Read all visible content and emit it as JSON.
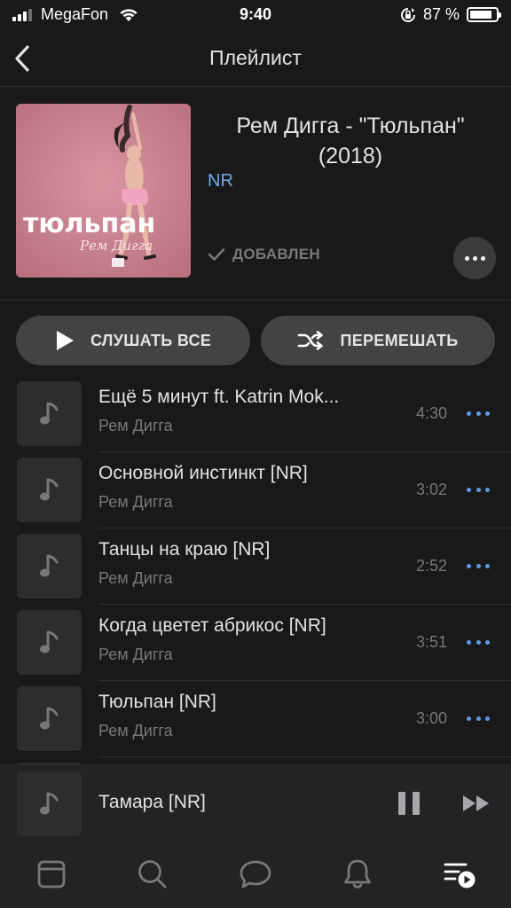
{
  "status_bar": {
    "carrier": "MegaFon",
    "time": "9:40",
    "battery_percent": "87 %",
    "battery_level": 0.87,
    "signal_bars": 4,
    "signal_bars_filled": 3
  },
  "header": {
    "title": "Плейлист",
    "back_icon": "chevron-left-icon"
  },
  "album": {
    "title": "Рем Дигга - \"Тюльпан\" (2018)",
    "artist": "NR",
    "added_label": "ДОБАВЛЕН",
    "cover_title": "тюльпан",
    "cover_artist": "Рем Дигга"
  },
  "actions": {
    "play_all_label": "СЛУШАТЬ ВСЕ",
    "shuffle_label": "ПЕРЕМЕШАТЬ"
  },
  "tracks": [
    {
      "title": "Ещё 5 минут ft. Katrin Mok...",
      "artist": "Рем Дигга",
      "duration": "4:30"
    },
    {
      "title": "Основной инстинкт [NR]",
      "artist": "Рем Дигга",
      "duration": "3:02"
    },
    {
      "title": "Танцы на краю [NR]",
      "artist": "Рем Дигга",
      "duration": "2:52"
    },
    {
      "title": "Когда цветет абрикос [NR]",
      "artist": "Рем Дигга",
      "duration": "3:51"
    },
    {
      "title": "Тюльпан [NR]",
      "artist": "Рем Дигга",
      "duration": "3:00"
    }
  ],
  "now_playing": {
    "title": "Тамара [NR]"
  },
  "tabbar": {
    "items": [
      "news-icon",
      "search-icon",
      "messages-icon",
      "notifications-icon",
      "music-icon"
    ],
    "active": "music-icon"
  },
  "colors": {
    "background": "#19191a",
    "accent": "#71aaeb",
    "secondary_text": "#76787a",
    "button_bg": "#424343"
  }
}
